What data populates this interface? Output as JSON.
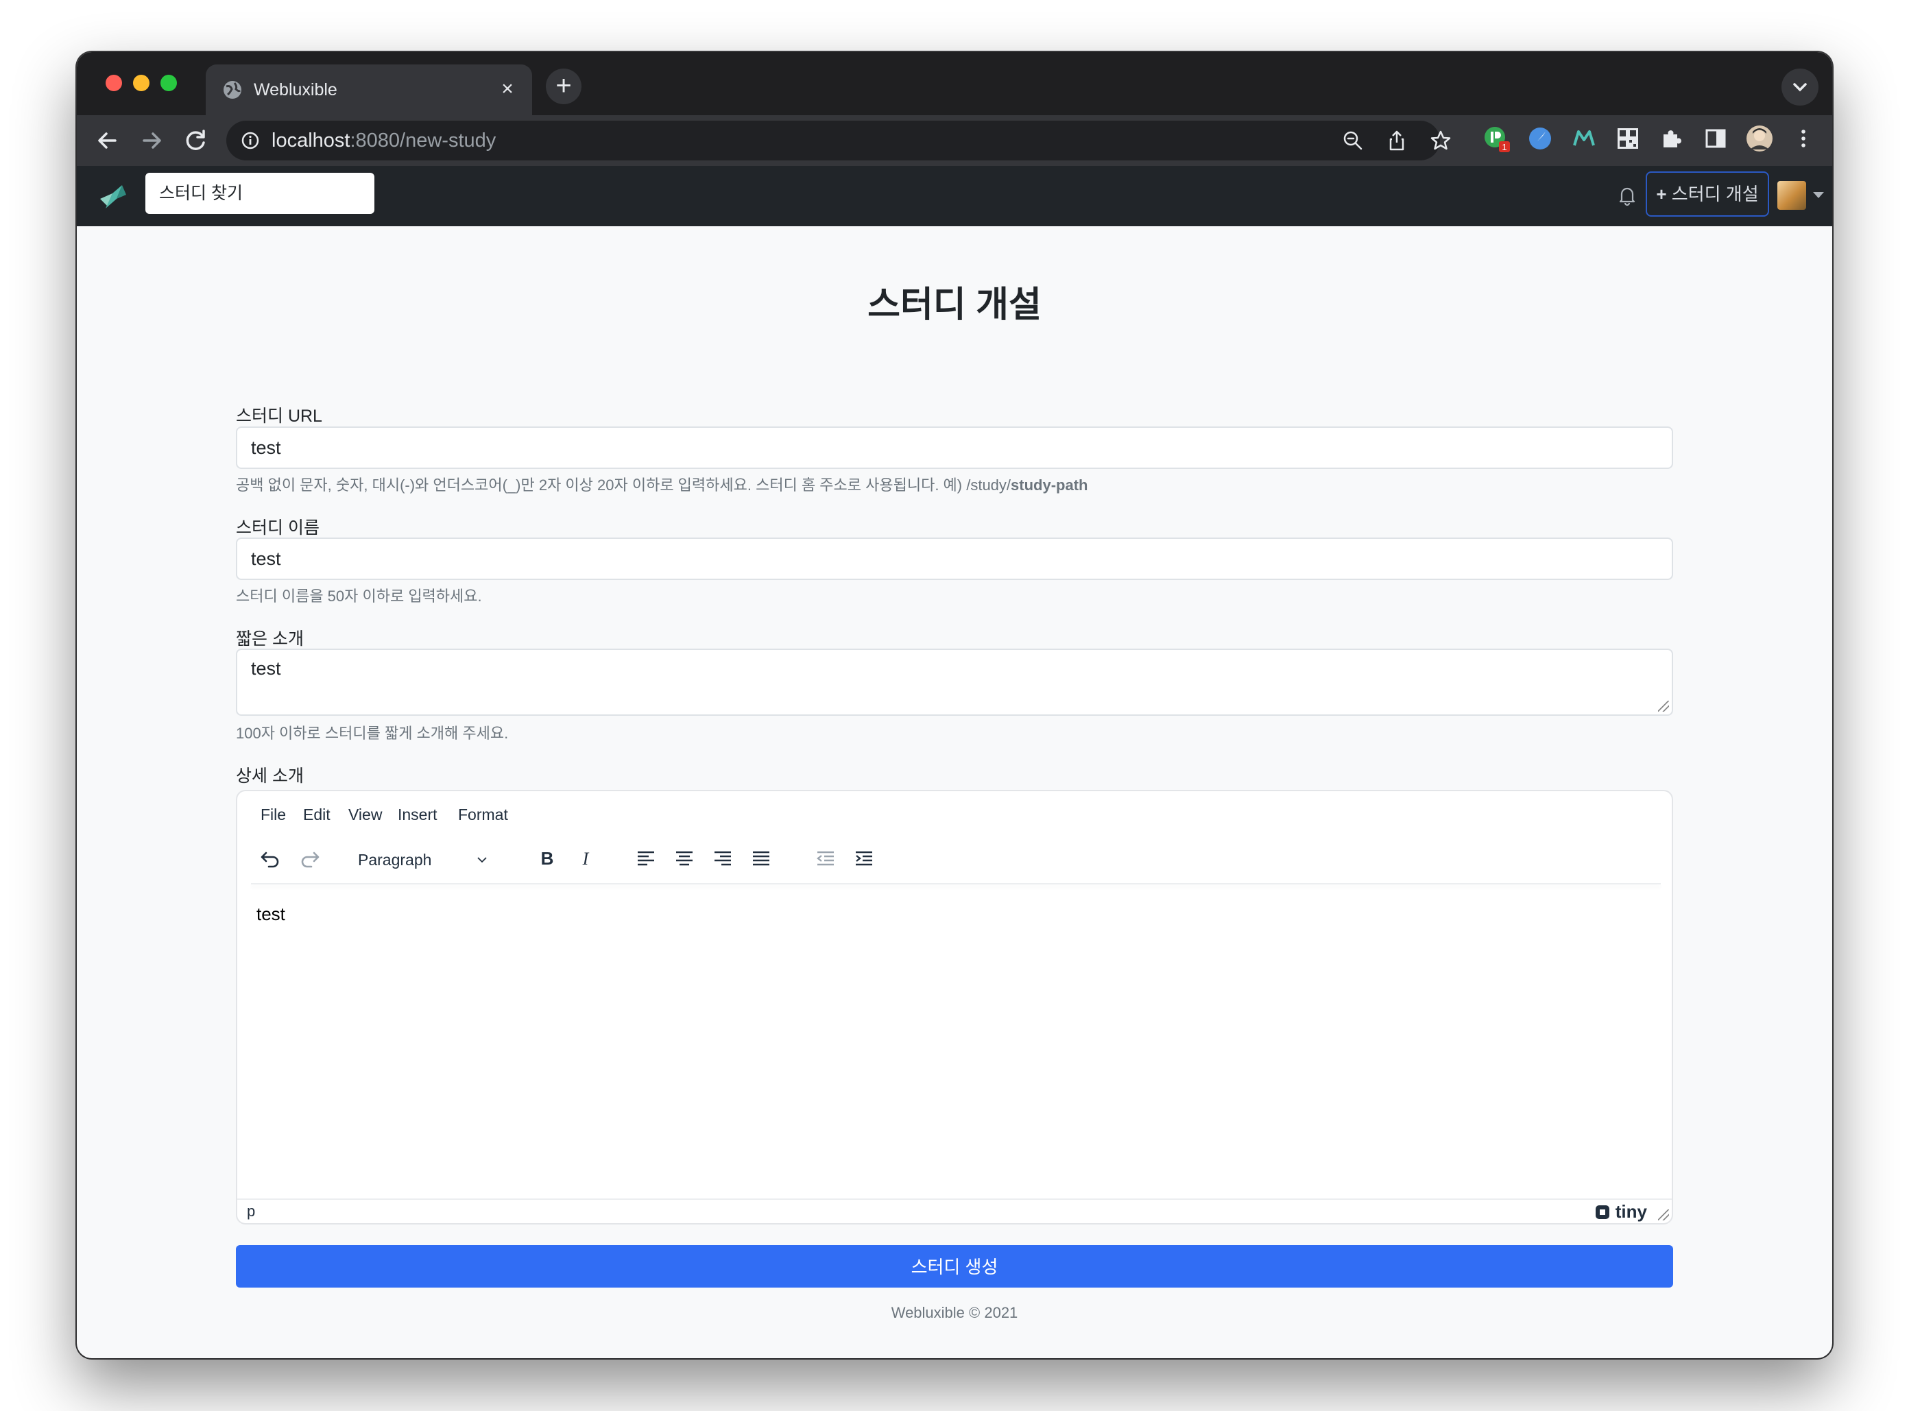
{
  "browser": {
    "tab_title": "Webluxible",
    "url_host": "localhost",
    "url_path": ":8080/new-study",
    "extension_badge": "1"
  },
  "navbar": {
    "search_placeholder": "스터디 찾기",
    "create_label": "스터디 개설"
  },
  "page": {
    "title": "스터디 개설"
  },
  "form": {
    "path": {
      "label": "스터디 URL",
      "value": "test",
      "help_prefix": "공백 없이 문자, 숫자, 대시(-)와 언더스코어(_)만 2자 이상 20자 이하로 입력하세요. 스터디 홈 주소로 사용됩니다. 예) /study/",
      "help_bold": "study-path"
    },
    "title": {
      "label": "스터디 이름",
      "value": "test",
      "help": "스터디 이름을 50자 이하로 입력하세요."
    },
    "short_description": {
      "label": "짧은 소개",
      "value": "test",
      "help": "100자 이하로 스터디를 짧게 소개해 주세요."
    },
    "full_description": {
      "label": "상세 소개"
    },
    "submit_label": "스터디 생성"
  },
  "editor": {
    "menus": [
      "File",
      "Edit",
      "View",
      "Insert",
      "Format"
    ],
    "block_format": "Paragraph",
    "content": "test",
    "status_path": "p",
    "brand": "tiny"
  },
  "footer": {
    "text": "Webluxible © 2021"
  },
  "colors": {
    "primary": "#316df4",
    "navbar": "#212529",
    "browser_chrome": "#35363a"
  }
}
